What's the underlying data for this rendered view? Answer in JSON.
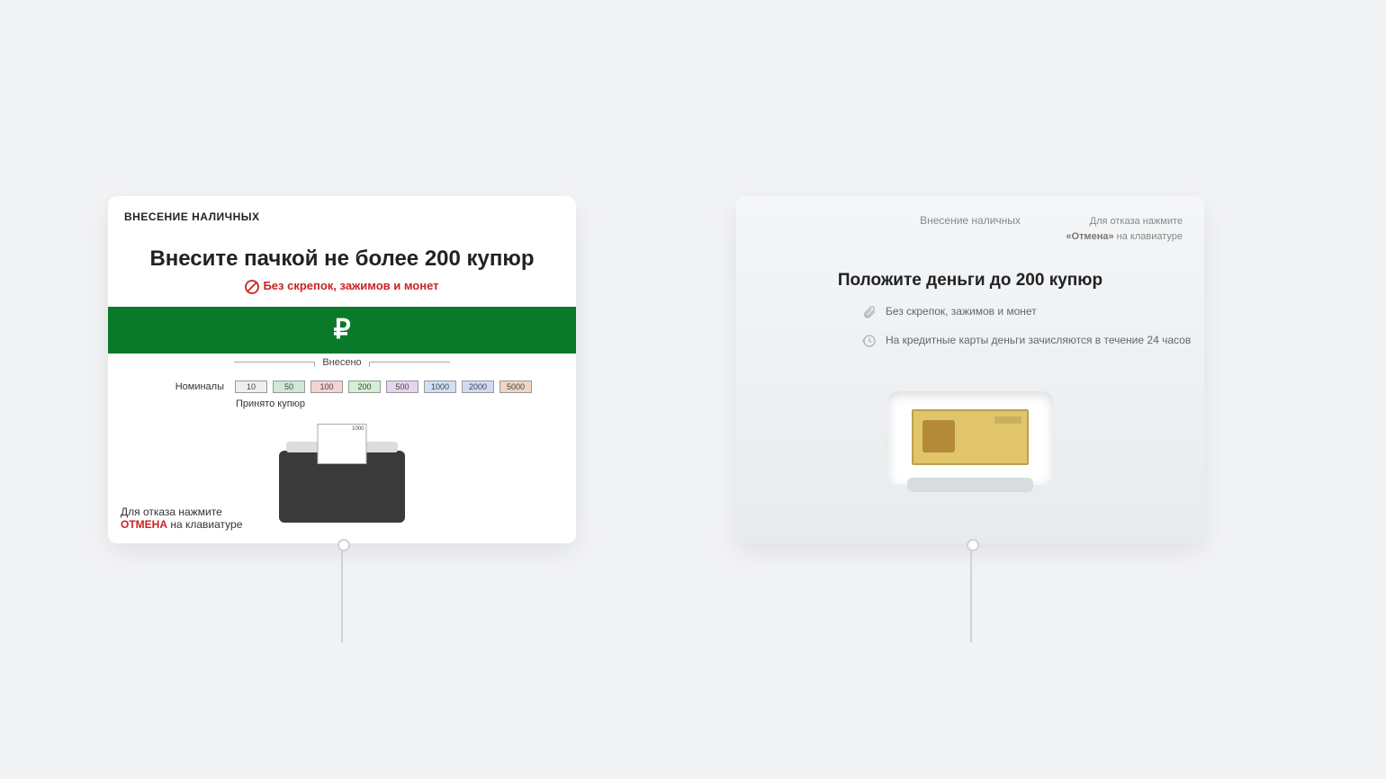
{
  "left": {
    "header": "ВНЕСЕНИЕ НАЛИЧНЫХ",
    "title": "Внесите пачкой не более 200 купюр",
    "warning": "Без скрепок, зажимов и монет",
    "deposited_label": "Внесено",
    "denom_label": "Номиналы",
    "denominations": [
      "10",
      "50",
      "100",
      "200",
      "500",
      "1000",
      "2000",
      "5000"
    ],
    "accepted_label": "Принято купюр",
    "footer_line1": "Для отказа нажмите",
    "footer_cancel": "ОТМЕНА",
    "footer_line2": " на клавиатуре",
    "currency": "₽"
  },
  "right": {
    "header": "Внесение наличных",
    "hint_line1": "Для отказа нажмите",
    "hint_cancel": "«Отмена»",
    "hint_line2": " на клавиатуре",
    "title": "Положите деньги до 200 купюр",
    "tip1": "Без скрепок, зажимов и монет",
    "tip2": "На кредитные карты деньги зачисляются в течение 24 часов"
  }
}
